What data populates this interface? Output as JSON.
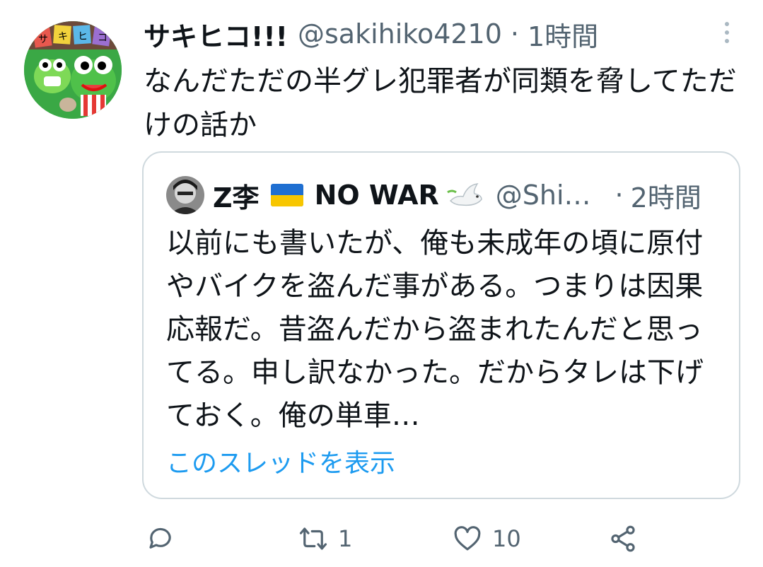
{
  "tweet": {
    "display_name": "サキヒコ!!!",
    "handle": "@sakihiko4210",
    "separator": "·",
    "time": "1時間",
    "text": "なんだただの半グレ犯罪者が同類を脅してただけの話か",
    "avatar_icon": "frog-character-avatar",
    "avatar_sign_text": "サキヒコ",
    "more_icon": "more-vertical-icon"
  },
  "quote": {
    "display_name": "Z李",
    "flag_icon": "ukraine-flag-icon",
    "name_suffix": "NO WAR",
    "dove_icon": "dove-icon",
    "handle": "@Shi…",
    "separator": "·",
    "time": "2時間",
    "text": "以前にも書いたが、俺も未成年の頃に原付やバイクを盗んだ事がある。つまりは因果応報だ。昔盗んだから盗まれたんだと思ってる。申し訳なかった。だからタレは下げておく。俺の単車…",
    "show_thread": "このスレッドを表示"
  },
  "actions": {
    "reply_count": "",
    "retweet_count": "1",
    "like_count": "10",
    "icons": [
      "reply-icon",
      "retweet-icon",
      "like-icon",
      "share-icon"
    ]
  },
  "colors": {
    "text": "#0f1419",
    "muted": "#536471",
    "link": "#1d9bf0",
    "border": "#cfd9de"
  }
}
